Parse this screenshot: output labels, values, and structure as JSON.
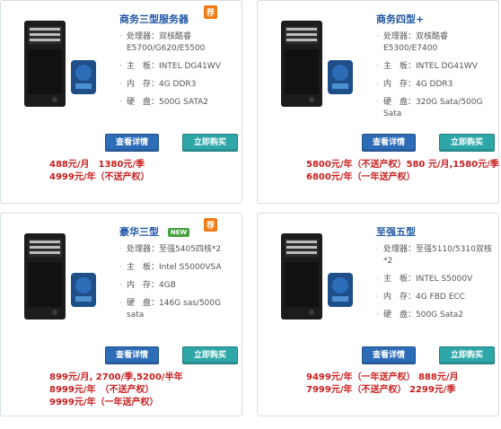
{
  "products": [
    {
      "name": "商务三型服务器",
      "badge": "荐",
      "specs": [
        "处理器：双核酷睿 E5700/G620/E5500",
        "主　板：INTEL DG41WV",
        "内　存：4G DDR3",
        "硬　盘：500G SATA2"
      ],
      "buttons": {
        "detail": "查看详情",
        "buy": "立即购买"
      },
      "prices": [
        "488元/月　1380元/季",
        "4999元/年（不送产权）"
      ]
    },
    {
      "name": "商务四型+",
      "badge": "",
      "specs": [
        "处理器：双核酷睿 E5300/E7400",
        "主　板：INTEL DG41WV",
        "内　存：4G DDR3",
        "硬　盘：320G Sata/500G Sata"
      ],
      "buttons": {
        "detail": "查看详情",
        "buy": "立即购买"
      },
      "prices": [
        "5800元/年（不送产权）580 元/月,1580元/季",
        "6800元/年（一年送产权）"
      ]
    },
    {
      "name": "豪华三型",
      "badge": "荐",
      "new_badge": "NEW",
      "specs": [
        "处理器：至强5405四核*2",
        "主　板：Intel S5000VSA",
        "内　存：4GB",
        "硬　盘：146G sas/500G sata"
      ],
      "buttons": {
        "detail": "查看详情",
        "buy": "立即购买"
      },
      "prices": [
        "899元/月, 2700/季,5200/半年",
        "8999元/年　（不送产权）",
        "9999元/年（一年送产权）"
      ]
    },
    {
      "name": "至强五型",
      "badge": "",
      "specs": [
        "处理器：至强5110/5310双核*2",
        "主　板：INTEL S5000V",
        "内　存：4G FBD ECC",
        "硬　盘：500G Sata2"
      ],
      "buttons": {
        "detail": "查看详情",
        "buy": "立即购买"
      },
      "prices": [
        "9499元/年（一年送产权） 888元/月",
        "7999元/年（不送产权） 2299元/季"
      ]
    }
  ]
}
